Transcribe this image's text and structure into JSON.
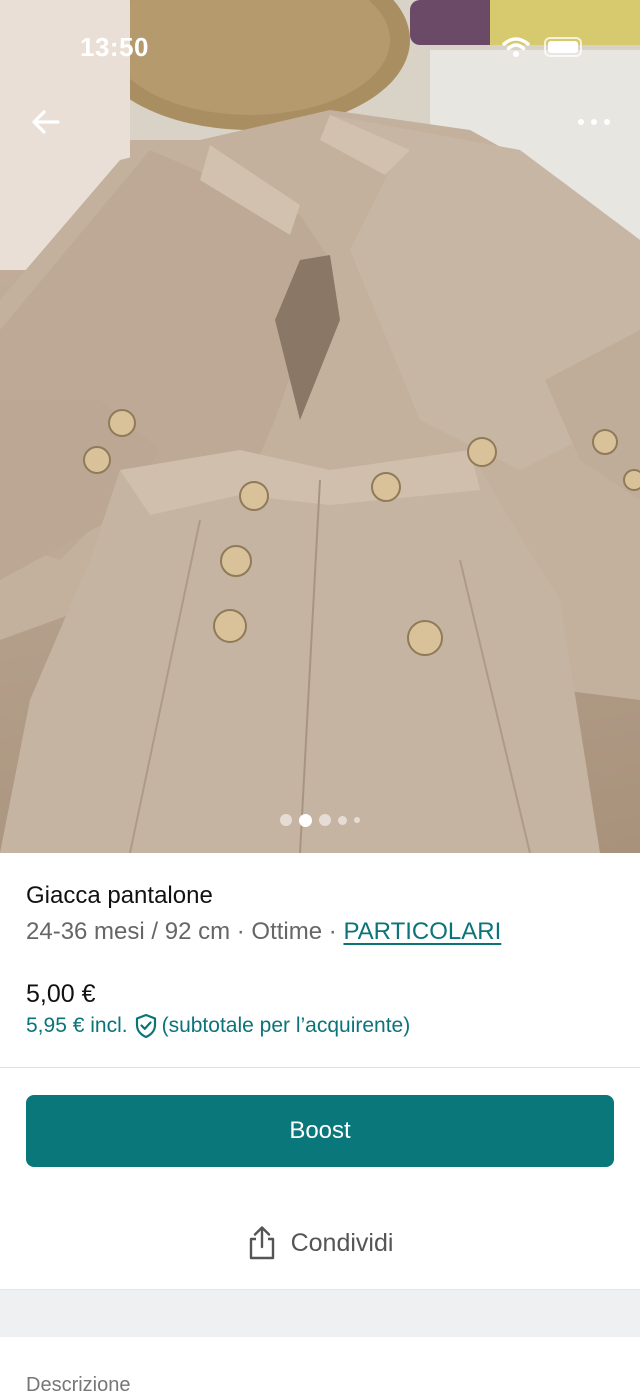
{
  "status_bar": {
    "time": "13:50"
  },
  "nav": {
    "back_icon": "arrow-left-icon",
    "more_icon": "more-horizontal-icon"
  },
  "gallery": {
    "image_count": 5,
    "active_index": 1
  },
  "item": {
    "title": "Giacca pantalone",
    "size": "24-36 mesi / 92 cm",
    "separator": " · ",
    "condition": "Ottime",
    "details_link": "PARTICOLARI",
    "price": "5,00 €",
    "price_incl": "5,95 € incl.",
    "price_incl_note": "(subtotale per l’acquirente)"
  },
  "actions": {
    "boost_label": "Boost",
    "share_label": "Condividi"
  },
  "description": {
    "label": "Descrizione"
  },
  "colors": {
    "accent": "#0a777b",
    "link": "#0a7479"
  }
}
